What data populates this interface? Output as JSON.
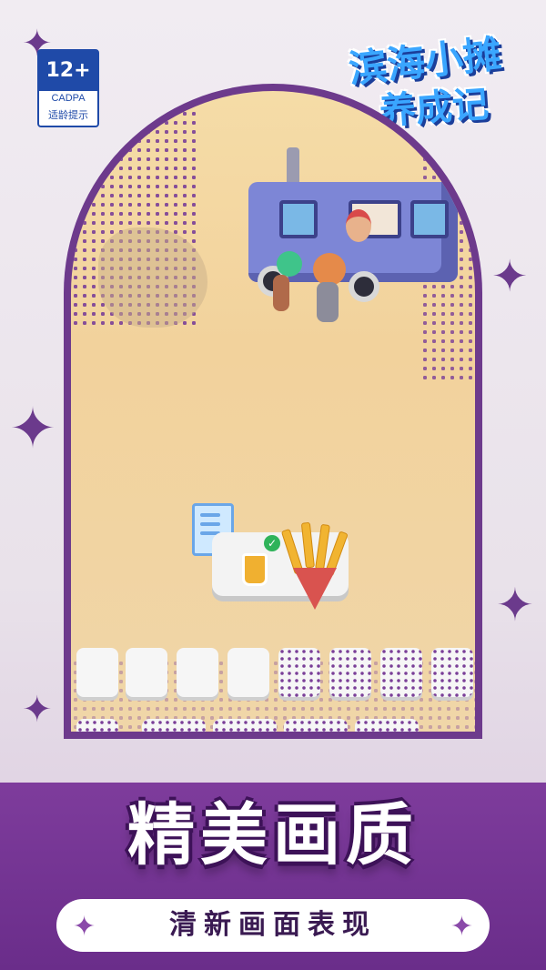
{
  "rating": {
    "age": "12+",
    "org": "CADPA",
    "tip": "适龄提示"
  },
  "game_title": {
    "line1": "滨海小摊",
    "line2": "养成记"
  },
  "headline": "精美画质",
  "subheadline": "清新画面表现",
  "colors": {
    "frame": "#6d3a8c",
    "banner": "#7e3c9c",
    "sand": "#f2d29c",
    "title_blue": "#3aa6ff"
  },
  "order": {
    "items": [
      "juice-icon",
      "fries-icon"
    ],
    "status": "check-icon"
  }
}
